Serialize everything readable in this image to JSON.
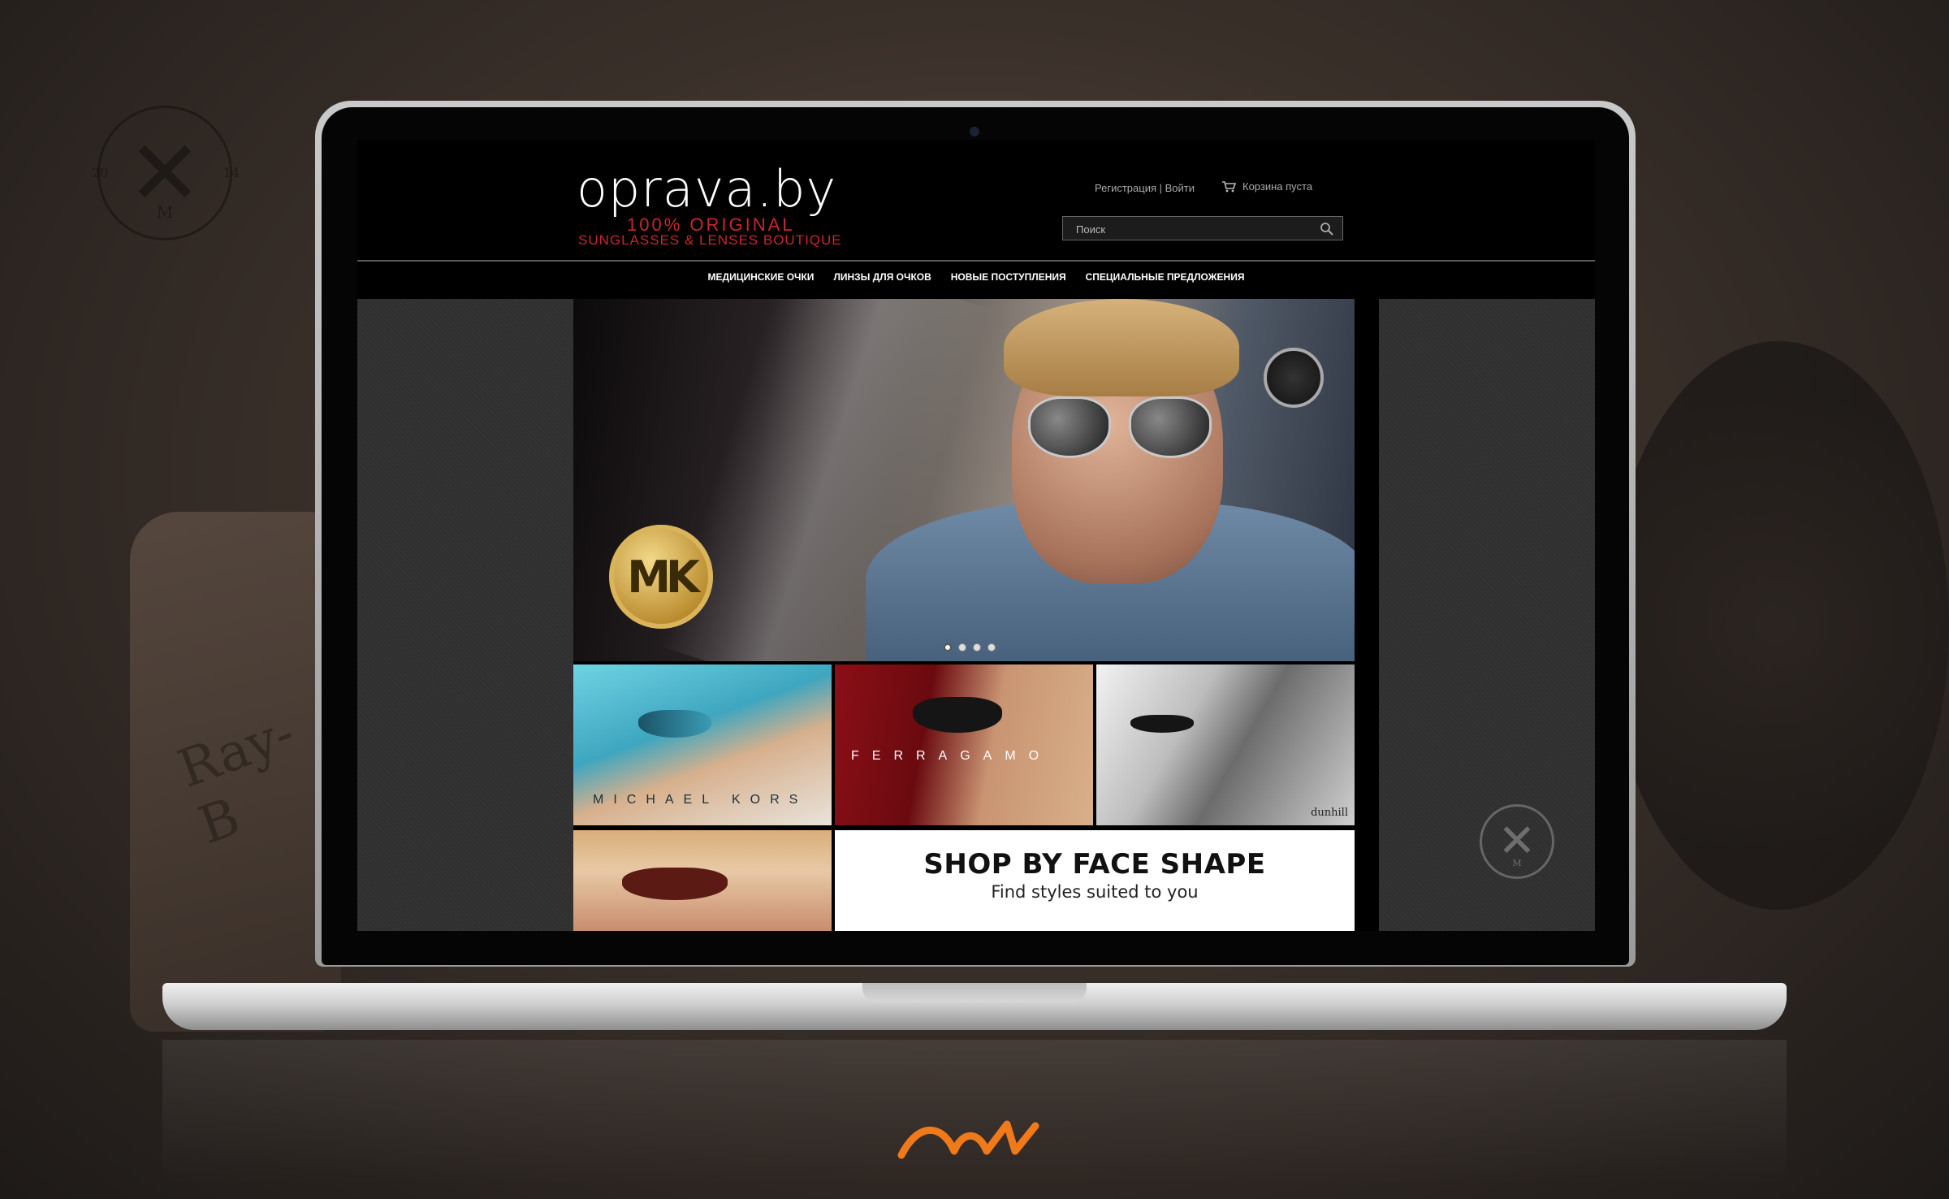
{
  "site": {
    "logo_text": "oprava.by",
    "logo_tagline_1": "100% ORIGINAL",
    "logo_tagline_2": "SUNGLASSES & LENSES BOUTIQUE"
  },
  "header": {
    "register_label": "Регистрация",
    "separator": "|",
    "login_label": "Войти",
    "cart_label": "Корзина пуста",
    "search_placeholder": "Поиск"
  },
  "nav": {
    "items": [
      {
        "label": "МЕДИЦИНСКИЕ ОЧКИ"
      },
      {
        "label": "ЛИНЗЫ ДЛЯ ОЧКОВ"
      },
      {
        "label": "НОВЫЕ ПОСТУПЛЕНИЯ"
      },
      {
        "label": "СПЕЦИАЛЬНЫЕ ПРЕДЛОЖЕНИЯ"
      }
    ]
  },
  "hero": {
    "brand_badge": "MK",
    "slide_count": 4,
    "active_slide": 1
  },
  "tiles": [
    {
      "label": "MICHAEL KORS"
    },
    {
      "label": "FERRAGAMO"
    },
    {
      "label": "dunhill"
    },
    {
      "label": ""
    }
  ],
  "promo": {
    "title": "SHOP BY FACE SHAPE",
    "subtitle": "Find styles suited to you"
  },
  "decor": {
    "stamp_year_left": "20",
    "stamp_year_right": "14",
    "stamp_letter": "M",
    "pouch_text": "Ray-B"
  },
  "colors": {
    "accent_red": "#c9272b",
    "footer_logo": "#f07a1a"
  }
}
